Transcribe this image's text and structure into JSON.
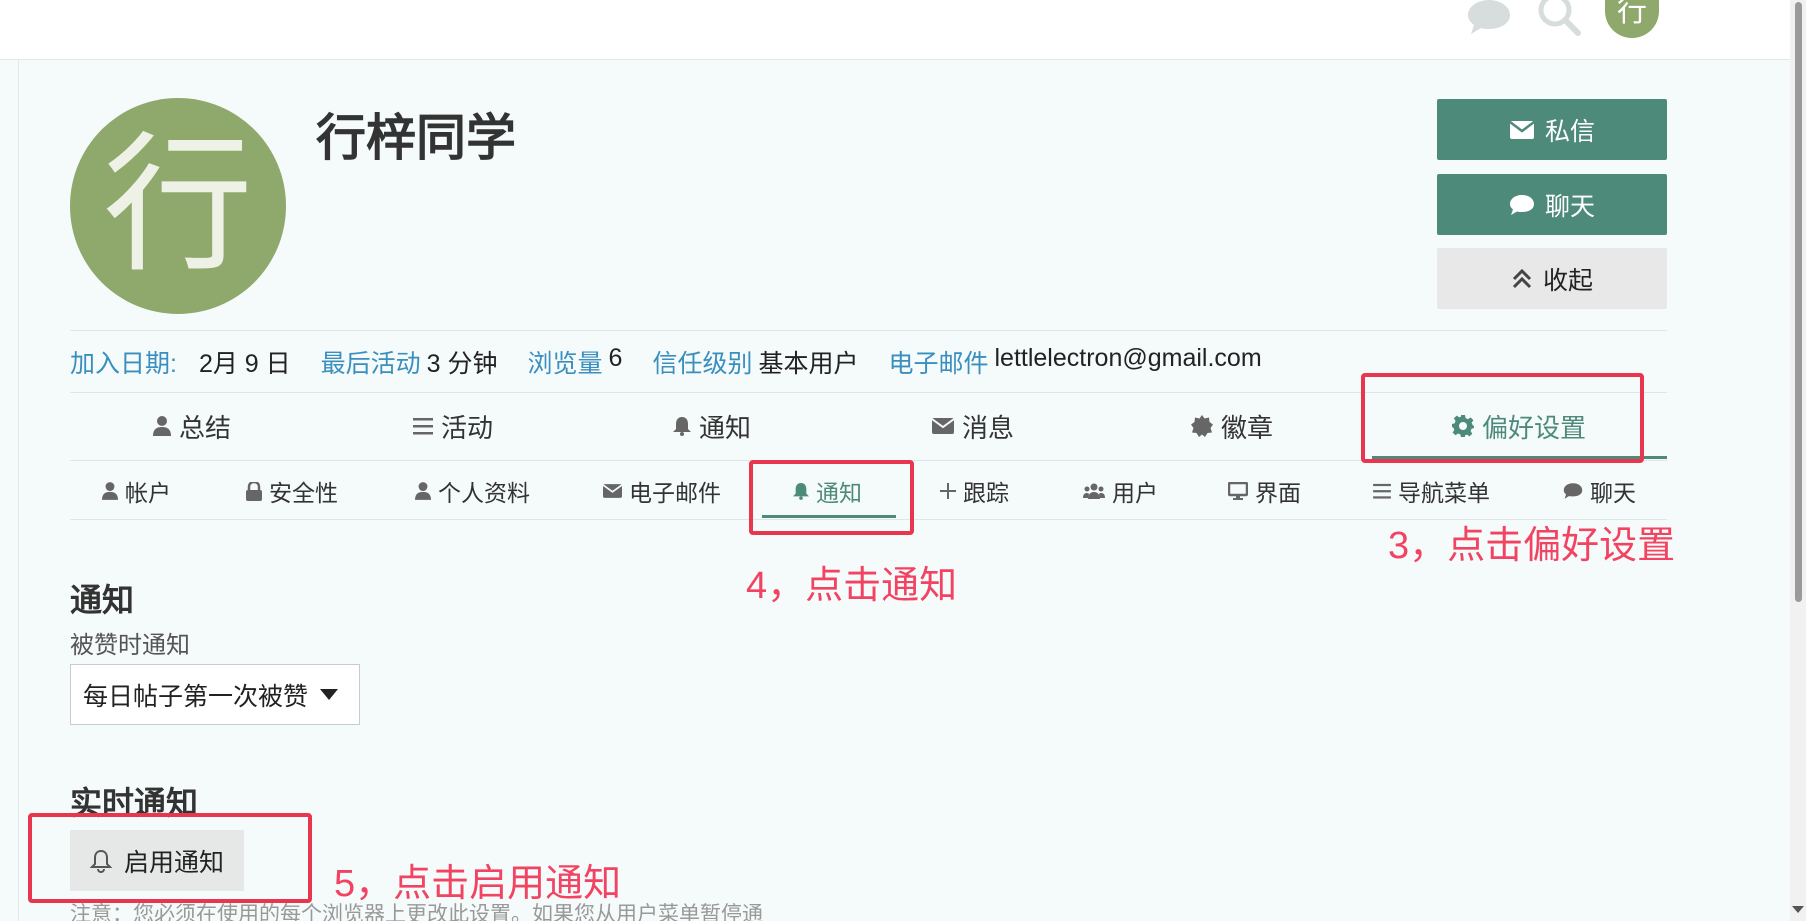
{
  "topbar": {
    "icons": [
      "chat-bubble-icon",
      "search-icon"
    ],
    "avatar_letter": "行"
  },
  "profile": {
    "avatar_letter": "行",
    "username": "行梓同学"
  },
  "actions": {
    "message_label": "私信",
    "chat_label": "聊天",
    "collapse_label": "收起"
  },
  "meta": {
    "joined_label": "加入日期:",
    "joined_value": "2月 9 日",
    "last_active_label": "最后活动",
    "last_active_value": "3 分钟",
    "views_label": "浏览量",
    "views_value": "6",
    "trust_label": "信任级别",
    "trust_value": "基本用户",
    "email_label": "电子邮件",
    "email_value": "lettlelectron@gmail.com"
  },
  "nav_main": [
    {
      "label": "总结",
      "icon": "user-icon"
    },
    {
      "label": "活动",
      "icon": "list-icon"
    },
    {
      "label": "通知",
      "icon": "bell-icon"
    },
    {
      "label": "消息",
      "icon": "envelope-icon"
    },
    {
      "label": "徽章",
      "icon": "badge-icon"
    },
    {
      "label": "偏好设置",
      "icon": "gear-icon",
      "active": true
    }
  ],
  "nav_sub": [
    {
      "label": "帐户",
      "icon": "user-icon"
    },
    {
      "label": "安全性",
      "icon": "lock-icon"
    },
    {
      "label": "个人资料",
      "icon": "user-icon"
    },
    {
      "label": "电子邮件",
      "icon": "envelope-icon"
    },
    {
      "label": "通知",
      "icon": "bell-icon",
      "active": true
    },
    {
      "label": "跟踪",
      "icon": "plus-icon"
    },
    {
      "label": "用户",
      "icon": "users-icon"
    },
    {
      "label": "界面",
      "icon": "desktop-icon"
    },
    {
      "label": "导航菜单",
      "icon": "list-icon"
    },
    {
      "label": "聊天",
      "icon": "chat-bubble-icon"
    }
  ],
  "annotations": {
    "step3": "3，点击偏好设置",
    "step4": "4，点击通知",
    "step5": "5，点击启用通知"
  },
  "notifications": {
    "title": "通知",
    "like_label": "被赞时通知",
    "like_selected": "每日帖子第一次被赞",
    "realtime_title": "实时通知",
    "enable_label": "启用通知",
    "note": "注意：您必须在使用的每个浏览器上更改此设置。如果您从用户菜单暂停通"
  },
  "colors": {
    "accent": "#4e8a7a",
    "link": "#3a8fbf",
    "avatar_bg": "#8fa86c",
    "annotation": "#f24462",
    "annotation_box": "#e8364f"
  }
}
